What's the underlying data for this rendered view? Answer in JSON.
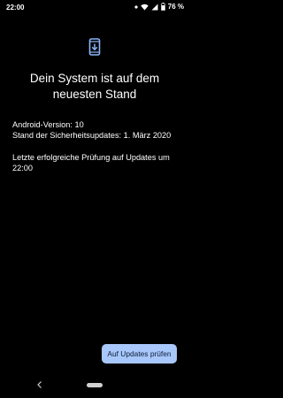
{
  "status_bar": {
    "time": "22:00",
    "battery_percent": "76 %",
    "icons": [
      "dot-icon",
      "wifi-icon",
      "signal-icon",
      "battery-icon"
    ]
  },
  "screen": {
    "icon": "system-update-phone-icon",
    "title": "Dein System ist auf dem neuesten Stand",
    "android_version": "Android-Version: 10",
    "security_patch": "Stand der Sicherheitsupdates: 1. März 2020",
    "last_check": "Letzte erfolgreiche Prüfung auf Updates um 22:00",
    "check_button_label": "Auf Updates prüfen"
  },
  "nav_bar": {
    "icons": [
      "back-icon",
      "home-pill"
    ]
  },
  "colors": {
    "background": "#000000",
    "text": "#ffffff",
    "accent_icon": "#8ab4f8",
    "button_bg": "#a8c7fa",
    "button_text": "#0b1d3a"
  }
}
